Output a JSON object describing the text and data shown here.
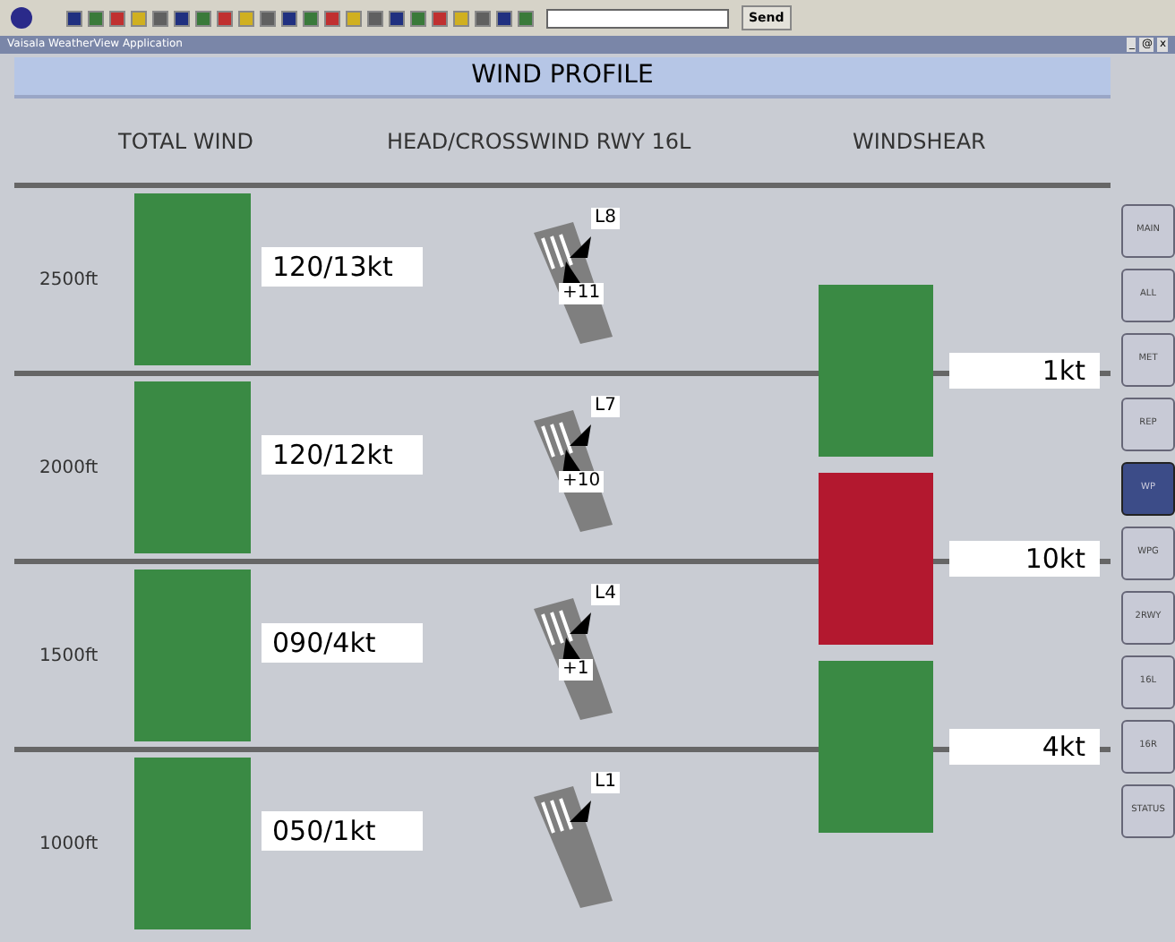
{
  "toolbar": {
    "send_label": "Send"
  },
  "window": {
    "title": "Vaisala WeatherView Application",
    "controls": [
      "_",
      "@",
      "x"
    ]
  },
  "panel": {
    "title": "WIND PROFILE",
    "columns": [
      "TOTAL WIND",
      "HEAD/CROSSWIND RWY 16L",
      "WINDSHEAR"
    ]
  },
  "rows": [
    {
      "altitude": "2500ft",
      "total_wind": "120/13kt",
      "crosswind": "L8",
      "headwind": "+11"
    },
    {
      "altitude": "2000ft",
      "total_wind": "120/12kt",
      "crosswind": "L7",
      "headwind": "+10"
    },
    {
      "altitude": "1500ft",
      "total_wind": "090/4kt",
      "crosswind": "L4",
      "headwind": "+1"
    },
    {
      "altitude": "1000ft",
      "total_wind": "050/1kt",
      "crosswind": "L1"
    }
  ],
  "windshear": [
    {
      "value": "1kt",
      "color": "#3a8a44"
    },
    {
      "value": "10kt",
      "color": "#b3182f"
    },
    {
      "value": "4kt",
      "color": "#3a8a44"
    }
  ],
  "nav": [
    {
      "label": "MAIN",
      "selected": false
    },
    {
      "label": "ALL",
      "selected": false
    },
    {
      "label": "MET",
      "selected": false
    },
    {
      "label": "REP",
      "selected": false
    },
    {
      "label": "WP",
      "selected": true
    },
    {
      "label": "WPG",
      "selected": false
    },
    {
      "label": "2RWY",
      "selected": false
    },
    {
      "label": "16L",
      "selected": false
    },
    {
      "label": "16R",
      "selected": false
    },
    {
      "label": "STATUS",
      "selected": false
    }
  ]
}
